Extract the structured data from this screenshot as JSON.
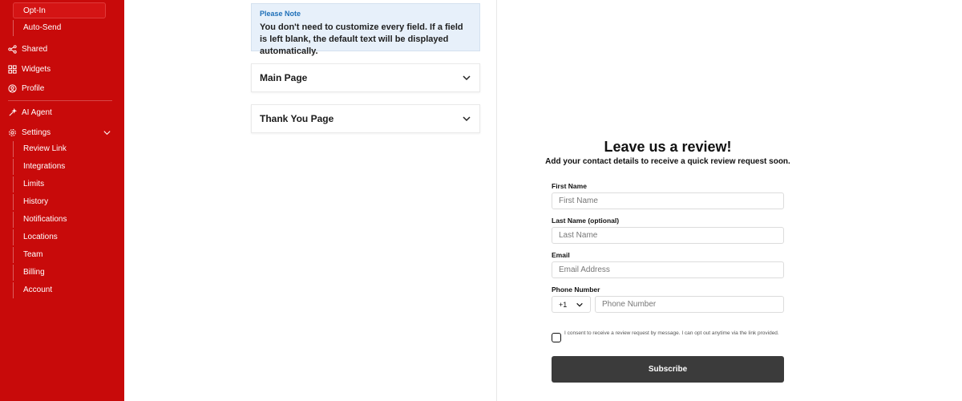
{
  "sidebar": {
    "top_subitems": [
      {
        "label": "Opt-In",
        "active": true
      },
      {
        "label": "Auto-Send",
        "active": false
      }
    ],
    "nav": [
      {
        "label": "Shared",
        "icon": "share-icon"
      },
      {
        "label": "Widgets",
        "icon": "widgets-icon"
      },
      {
        "label": "Profile",
        "icon": "profile-icon"
      },
      {
        "label": "AI Agent",
        "icon": "ai-agent-icon"
      },
      {
        "label": "Settings",
        "icon": "gear-icon"
      }
    ],
    "settings_subitems": [
      {
        "label": "Review Link"
      },
      {
        "label": "Integrations"
      },
      {
        "label": "Limits"
      },
      {
        "label": "History"
      },
      {
        "label": "Notifications"
      },
      {
        "label": "Locations"
      },
      {
        "label": "Team"
      },
      {
        "label": "Billing"
      },
      {
        "label": "Account"
      }
    ],
    "color": "#c80a0a"
  },
  "editor": {
    "note_title": "Please Note",
    "note_text": "You don't need to customize every field. If a field is left blank, the default text will be displayed automatically.",
    "sections": [
      {
        "title": "Main Page"
      },
      {
        "title": "Thank You Page"
      }
    ]
  },
  "preview": {
    "headline": "Leave us a review!",
    "subheadline": "Add your contact details to receive a quick review request soon.",
    "first_name": {
      "label": "First Name",
      "placeholder": "First Name",
      "value": ""
    },
    "last_name": {
      "label": "Last Name (optional)",
      "placeholder": "Last Name",
      "value": ""
    },
    "email": {
      "label": "Email",
      "placeholder": "Email Address",
      "value": ""
    },
    "phone": {
      "label": "Phone Number",
      "country_code": "+1",
      "placeholder": "Phone Number",
      "value": ""
    },
    "consent_text": "I consent to receive a review request by message. I can opt out anytime via the link provided.",
    "consent_checked": false,
    "submit_label": "Subscribe",
    "button_color": "#3b3b3b"
  }
}
